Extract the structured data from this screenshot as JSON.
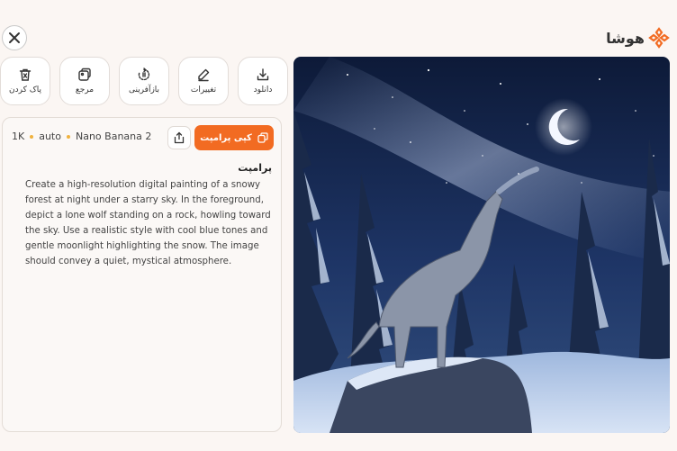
{
  "brand": {
    "name": "هوشا",
    "accent": "#f26b22"
  },
  "window": {
    "close_icon": "close-icon"
  },
  "toolbar": {
    "items": [
      {
        "label": "دانلود",
        "icon": "download-icon"
      },
      {
        "label": "تغییرات",
        "icon": "edit-icon"
      },
      {
        "label": "بازآفرینی",
        "icon": "regenerate-icon"
      },
      {
        "label": "مرجع",
        "icon": "reference-icon"
      },
      {
        "label": "پاک کردن",
        "icon": "trash-icon"
      }
    ]
  },
  "details": {
    "resolution": "1K",
    "aspect": "auto",
    "model": "Nano Banana 2",
    "copy_label": "کپی پرامپت",
    "section_title": "پرامپت",
    "prompt": "Create a high-resolution digital painting of a snowy forest at night under a starry sky. In the foreground, depict a lone wolf standing on a rock, howling toward the sky. Use a realistic style with cool blue tones and gentle moonlight highlighting the snow. The image should convey a quiet, mystical atmosphere."
  }
}
